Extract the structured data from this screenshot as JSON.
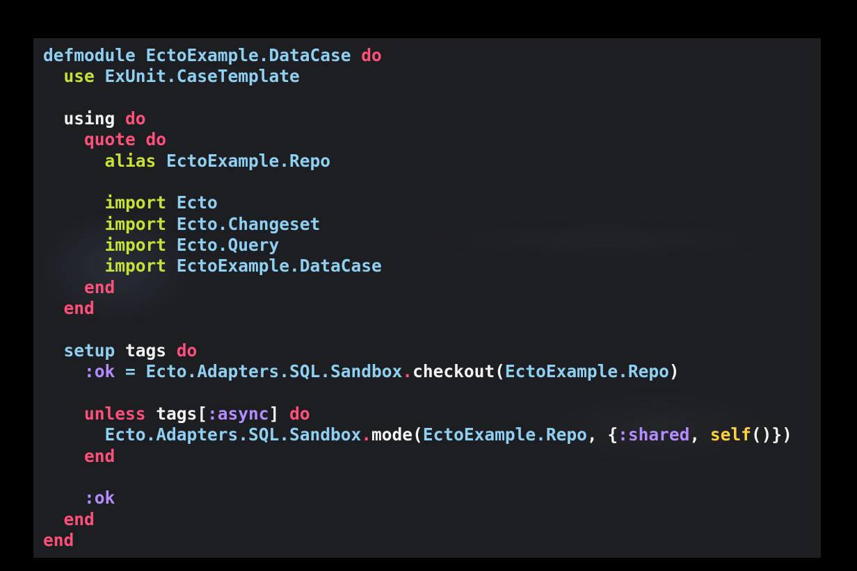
{
  "window": {
    "title": ""
  },
  "colors": {
    "background": "#000000",
    "panel": "#1d1e22",
    "keyword": "#ff4f7b",
    "directive": "#c7e236",
    "module": "#8fd0f2",
    "identifier": "#f2f2f2",
    "atom": "#b48cff",
    "self": "#ffd23a"
  },
  "code": {
    "lines": [
      [
        {
          "t": "defmodule ",
          "c": "id"
        },
        {
          "t": "EctoExample.DataCase ",
          "c": "id"
        },
        {
          "t": "do",
          "c": "kw"
        }
      ],
      [
        {
          "t": "  use ",
          "c": "dir"
        },
        {
          "t": "ExUnit.CaseTemplate",
          "c": "id"
        }
      ],
      [],
      [
        {
          "t": "  using ",
          "c": "var"
        },
        {
          "t": "do",
          "c": "kw"
        }
      ],
      [
        {
          "t": "    quote ",
          "c": "kw"
        },
        {
          "t": "do",
          "c": "kw"
        }
      ],
      [
        {
          "t": "      alias ",
          "c": "dir"
        },
        {
          "t": "EctoExample.Repo",
          "c": "id"
        }
      ],
      [],
      [
        {
          "t": "      import ",
          "c": "dir"
        },
        {
          "t": "Ecto",
          "c": "id"
        }
      ],
      [
        {
          "t": "      import ",
          "c": "dir"
        },
        {
          "t": "Ecto.Changeset",
          "c": "id"
        }
      ],
      [
        {
          "t": "      import ",
          "c": "dir"
        },
        {
          "t": "Ecto.Query",
          "c": "id"
        }
      ],
      [
        {
          "t": "      import ",
          "c": "dir"
        },
        {
          "t": "EctoExample.DataCase",
          "c": "id"
        }
      ],
      [
        {
          "t": "    end",
          "c": "kw"
        }
      ],
      [
        {
          "t": "  end",
          "c": "kw"
        }
      ],
      [],
      [
        {
          "t": "  setup ",
          "c": "id"
        },
        {
          "t": "tags ",
          "c": "var"
        },
        {
          "t": "do",
          "c": "kw"
        }
      ],
      [
        {
          "t": "    :ok",
          "c": "atom"
        },
        {
          "t": " = ",
          "c": "id"
        },
        {
          "t": "Ecto.Adapters.SQL.Sandbox",
          "c": "id"
        },
        {
          "t": ".",
          "c": "dot"
        },
        {
          "t": "checkout",
          "c": "var"
        },
        {
          "t": "(",
          "c": "punc"
        },
        {
          "t": "EctoExample.Repo",
          "c": "id"
        },
        {
          "t": ")",
          "c": "punc"
        }
      ],
      [],
      [
        {
          "t": "    unless ",
          "c": "kw"
        },
        {
          "t": "tags",
          "c": "var"
        },
        {
          "t": "[",
          "c": "punc"
        },
        {
          "t": ":async",
          "c": "atom"
        },
        {
          "t": "] ",
          "c": "punc"
        },
        {
          "t": "do",
          "c": "kw"
        }
      ],
      [
        {
          "t": "      Ecto.Adapters.SQL.Sandbox",
          "c": "id"
        },
        {
          "t": ".",
          "c": "dot"
        },
        {
          "t": "mode",
          "c": "var"
        },
        {
          "t": "(",
          "c": "punc"
        },
        {
          "t": "EctoExample.Repo",
          "c": "id"
        },
        {
          "t": ", {",
          "c": "punc"
        },
        {
          "t": ":shared",
          "c": "atom"
        },
        {
          "t": ", ",
          "c": "punc"
        },
        {
          "t": "self",
          "c": "self"
        },
        {
          "t": "()})",
          "c": "punc"
        }
      ],
      [
        {
          "t": "    end",
          "c": "kw"
        }
      ],
      [],
      [
        {
          "t": "    :ok",
          "c": "atom"
        }
      ],
      [
        {
          "t": "  end",
          "c": "kw"
        }
      ],
      [
        {
          "t": "end",
          "c": "kw"
        }
      ]
    ]
  }
}
